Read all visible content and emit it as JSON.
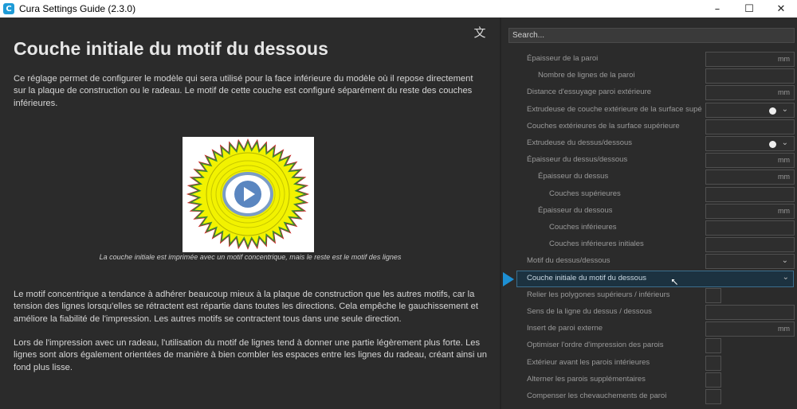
{
  "window": {
    "title": "Cura Settings Guide (2.3.0)",
    "icon": "cura-app-icon",
    "controls": [
      "minimize",
      "maximize",
      "close"
    ]
  },
  "article": {
    "title": "Couche initiale du motif du dessous",
    "intro": "Ce réglage permet de configurer le modèle qui sera utilisé pour la face inférieure du modèle où il repose directement sur la plaque de construction ou le radeau. Le motif de cette couche est configuré séparément du reste des couches inférieures.",
    "figure_caption": "La couche initiale est imprimée avec un motif concentrique, mais le reste est le motif des lignes",
    "para2": "Le motif concentrique a tendance à adhérer beaucoup mieux à la plaque de construction que les autres motifs, car la tension des lignes lorsqu'elles se rétractent est répartie dans toutes les directions. Cela empêche le gauchissement et améliore la fiabilité de l'impression. Les autres motifs se contractent tous dans une seule direction.",
    "para3": "Lors de l'impression avec un radeau, l'utilisation du motif de lignes tend à donner une partie légèrement plus forte. Les lignes sont alors également orientées de manière à bien combler les espaces entre les lignes du radeau, créant ainsi un fond plus lisse."
  },
  "search": {
    "placeholder": "Search..."
  },
  "settings": [
    {
      "label": "Épaisseur de la paroi",
      "indent": 0,
      "type": "number",
      "unit": "mm"
    },
    {
      "label": "Nombre de lignes de la paroi",
      "indent": 1,
      "type": "number",
      "unit": ""
    },
    {
      "label": "Distance d'essuyage paroi extérieure",
      "indent": 0,
      "type": "number",
      "unit": "mm"
    },
    {
      "label": "Extrudeuse de couche extérieure de la surface supé",
      "indent": 0,
      "type": "extruder",
      "unit": ""
    },
    {
      "label": "Couches extérieures de la surface supérieure",
      "indent": 0,
      "type": "number",
      "unit": ""
    },
    {
      "label": "Extrudeuse du dessus/dessous",
      "indent": 0,
      "type": "extruder",
      "unit": ""
    },
    {
      "label": "Épaisseur du dessus/dessous",
      "indent": 0,
      "type": "number",
      "unit": "mm"
    },
    {
      "label": "Épaisseur du dessus",
      "indent": 1,
      "type": "number",
      "unit": "mm"
    },
    {
      "label": "Couches supérieures",
      "indent": 2,
      "type": "number",
      "unit": ""
    },
    {
      "label": "Épaisseur du dessous",
      "indent": 1,
      "type": "number",
      "unit": "mm"
    },
    {
      "label": "Couches inférieures",
      "indent": 2,
      "type": "number",
      "unit": ""
    },
    {
      "label": "Couches inférieures initiales",
      "indent": 2,
      "type": "number",
      "unit": ""
    },
    {
      "label": "Motif du dessus/dessous",
      "indent": 0,
      "type": "dropdown",
      "unit": ""
    },
    {
      "label": "Couche initiale du motif du dessous",
      "indent": 0,
      "type": "dropdown",
      "unit": "",
      "selected": true
    },
    {
      "label": "Relier les polygones supérieurs / inférieurs",
      "indent": 0,
      "type": "checkbox",
      "unit": ""
    },
    {
      "label": "Sens de la ligne du dessus / dessous",
      "indent": 0,
      "type": "number",
      "unit": ""
    },
    {
      "label": "Insert de paroi externe",
      "indent": 0,
      "type": "number",
      "unit": "mm"
    },
    {
      "label": "Optimiser l'ordre d'impression des parois",
      "indent": 0,
      "type": "checkbox",
      "unit": ""
    },
    {
      "label": "Extérieur avant les parois intérieures",
      "indent": 0,
      "type": "checkbox",
      "unit": ""
    },
    {
      "label": "Alterner les parois supplémentaires",
      "indent": 0,
      "type": "checkbox",
      "unit": ""
    },
    {
      "label": "Compenser les chevauchements de paroi",
      "indent": 0,
      "type": "checkbox",
      "unit": ""
    }
  ],
  "colors": {
    "accent": "#1d8fd3",
    "highlight": "#1c3240",
    "background": "#2b2b2b"
  }
}
